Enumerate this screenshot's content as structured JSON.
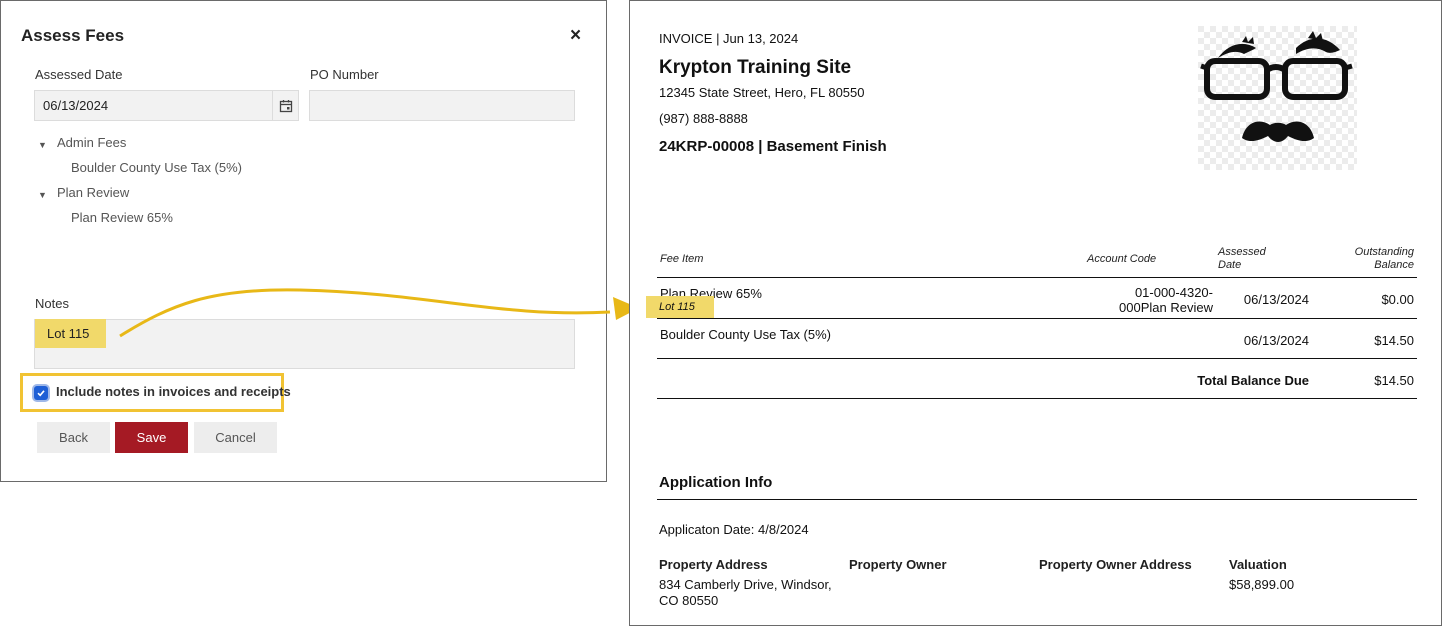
{
  "dialog": {
    "title": "Assess Fees",
    "close_glyph": "×",
    "assessed_date_label": "Assessed Date",
    "assessed_date_value": "06/13/2024",
    "po_number_label": "PO Number",
    "po_number_value": "",
    "fee_groups": [
      {
        "label": "Admin Fees",
        "items": [
          "Boulder County Use Tax (5%)"
        ]
      },
      {
        "label": "Plan Review",
        "items": [
          "Plan Review 65%"
        ]
      }
    ],
    "notes_label": "Notes",
    "notes_value": "Lot 115",
    "include_notes_label": "Include notes in invoices and receipts",
    "include_notes_checked": true,
    "back_label": "Back",
    "save_label": "Save",
    "cancel_label": "Cancel"
  },
  "invoice": {
    "header": "INVOICE |  Jun 13, 2024",
    "org_name": "Krypton Training Site",
    "street": "12345 State Street, Hero, FL 80550",
    "phone": "(987) 888-8888",
    "project": "24KRP-00008 | Basement Finish",
    "columns": {
      "fee_item": "Fee Item",
      "account_code": "Account Code",
      "assessed_date_1": "Assessed",
      "assessed_date_2": "Date",
      "outstanding_1": "Outstanding",
      "outstanding_2": "Balance"
    },
    "rows": [
      {
        "fee_item": "Plan Review 65%",
        "note": "Lot 115",
        "account_code_1": "01-000-4320-",
        "account_code_2": "000Plan Review",
        "assessed_date": "06/13/2024",
        "balance": "$0.00"
      },
      {
        "fee_item": "Boulder County Use Tax (5%)",
        "note": "",
        "account_code_1": "",
        "account_code_2": "",
        "assessed_date": "06/13/2024",
        "balance": "$14.50"
      }
    ],
    "total_label": "Total Balance Due",
    "total_value": "$14.50",
    "app_info_title": "Application Info",
    "app_date": "Applicaton Date: 4/8/2024",
    "property": {
      "address_label": "Property Address",
      "address_line1": "834 Camberly Drive, Windsor,",
      "address_line2": "CO 80550",
      "owner_label": "Property Owner",
      "owner_address_label": "Property Owner Address",
      "valuation_label": "Valuation",
      "valuation_value": "$58,899.00"
    }
  },
  "colors": {
    "highlight": "#f1d96a",
    "callout_border": "#f1c333",
    "arrow": "#e8b817",
    "save_button": "#a51a24",
    "checkbox": "#1e5fd6"
  },
  "icons": {
    "calendar": "calendar-icon",
    "close": "close-icon",
    "caret": "caret-down-icon",
    "check": "check-icon",
    "logo": "glasses-mustache-logo"
  }
}
